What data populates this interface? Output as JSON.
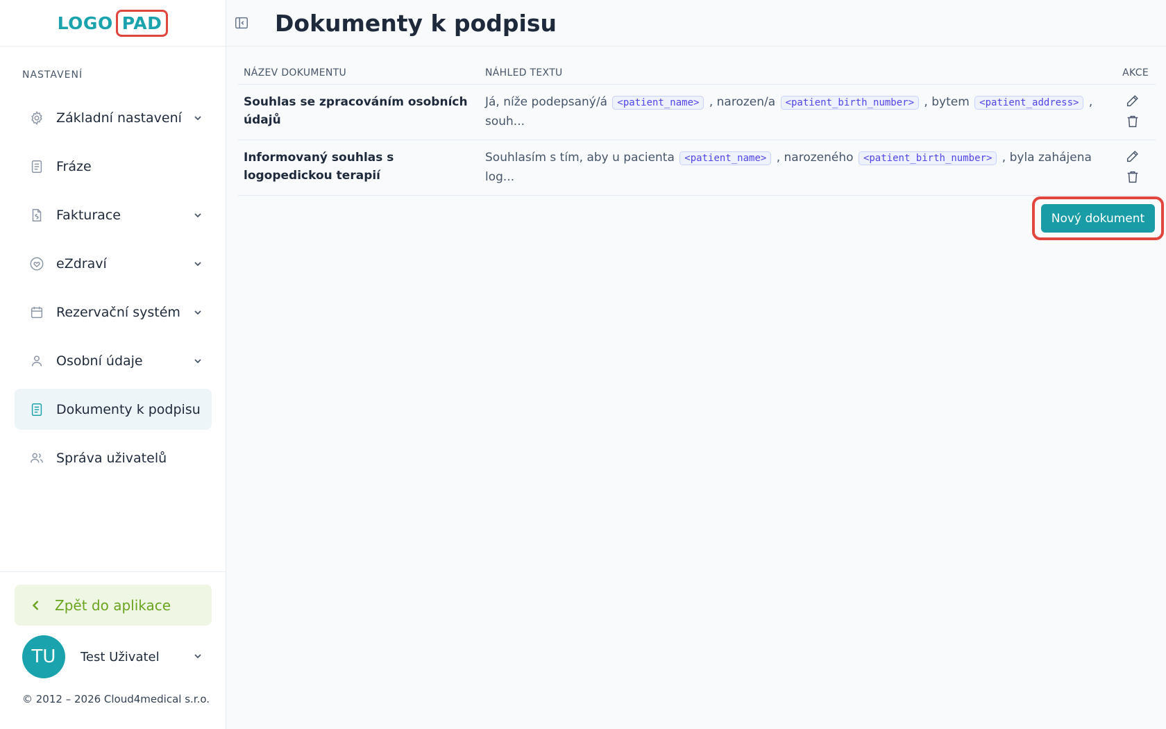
{
  "logo": {
    "left": "LOGO",
    "right": "PAD"
  },
  "sidebar": {
    "section_title": "NASTAVENÍ",
    "items": [
      {
        "label": "Základní nastavení",
        "icon": "gear-icon",
        "chevron": true,
        "active": false
      },
      {
        "label": "Fráze",
        "icon": "document-icon",
        "chevron": false,
        "active": false
      },
      {
        "label": "Fakturace",
        "icon": "invoice-icon",
        "chevron": true,
        "active": false
      },
      {
        "label": "eZdraví",
        "icon": "heart-icon",
        "chevron": true,
        "active": false
      },
      {
        "label": "Rezervační systém",
        "icon": "calendar-icon",
        "chevron": true,
        "active": false
      },
      {
        "label": "Osobní údaje",
        "icon": "user-icon",
        "chevron": true,
        "active": false
      },
      {
        "label": "Dokumenty k podpisu",
        "icon": "document-icon",
        "chevron": false,
        "active": true
      },
      {
        "label": "Správa uživatelů",
        "icon": "users-icon",
        "chevron": false,
        "active": false
      }
    ],
    "back_label": "Zpět do aplikace",
    "user": {
      "initials": "TU",
      "name": "Test Uživatel"
    },
    "copyright": "© 2012 – 2026 Cloud4medical s.r.o."
  },
  "header": {
    "title": "Dokumenty k podpisu"
  },
  "table": {
    "headers": {
      "name": "NÁZEV DOKUMENTU",
      "preview": "NÁHLED TEXTU",
      "actions": "AKCE"
    },
    "rows": [
      {
        "name": "Souhlas se zpracováním osobních údajů",
        "preview": [
          {
            "t": "text",
            "v": "Já, níže podepsaný/á "
          },
          {
            "t": "tag",
            "v": "<patient_name>"
          },
          {
            "t": "text",
            "v": " , narozen/a "
          },
          {
            "t": "tag",
            "v": "<patient_birth_number>"
          },
          {
            "t": "text",
            "v": " , bytem "
          },
          {
            "t": "tag",
            "v": "<patient_address>"
          },
          {
            "t": "text",
            "v": " , souh..."
          }
        ]
      },
      {
        "name": "Informovaný souhlas s logopedickou terapií",
        "preview": [
          {
            "t": "text",
            "v": "Souhlasím s tím, aby u pacienta "
          },
          {
            "t": "tag",
            "v": "<patient_name>"
          },
          {
            "t": "text",
            "v": " , narozeného "
          },
          {
            "t": "tag",
            "v": "<patient_birth_number>"
          },
          {
            "t": "text",
            "v": " , byla zahájena log..."
          }
        ]
      }
    ]
  },
  "new_document_label": "Nový dokument",
  "colors": {
    "accent": "#1aa3ad",
    "highlight": "#e0453e",
    "back_green": "#6aa41f"
  }
}
